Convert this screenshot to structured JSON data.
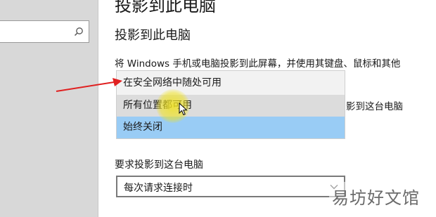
{
  "page": {
    "top_title": "投影到此电脑",
    "section_title": "投影到此电脑",
    "description": "将 Windows 手机或电脑投影到此屏幕，并使用其键盘、鼠标和其他",
    "side_text": "影到这台电脑"
  },
  "sidebar": {
    "search": {
      "placeholder": "",
      "icon": "search-icon"
    }
  },
  "dropdown": {
    "options": [
      {
        "label": "在安全网络中随处可用",
        "state": "normal"
      },
      {
        "label": "所有位置都可用",
        "state": "hover"
      },
      {
        "label": "始终关闭",
        "state": "selected"
      }
    ]
  },
  "pairing": {
    "label": "要求投影到这台电脑",
    "value": "每次请求连接时"
  },
  "annotation": {
    "arrow_color": "#e02020"
  },
  "colors": {
    "selected": "#99ccf5",
    "hover": "#dcdcdc",
    "highlight": "#f0e21e"
  },
  "watermark": {
    "text": "易坊好文馆"
  }
}
